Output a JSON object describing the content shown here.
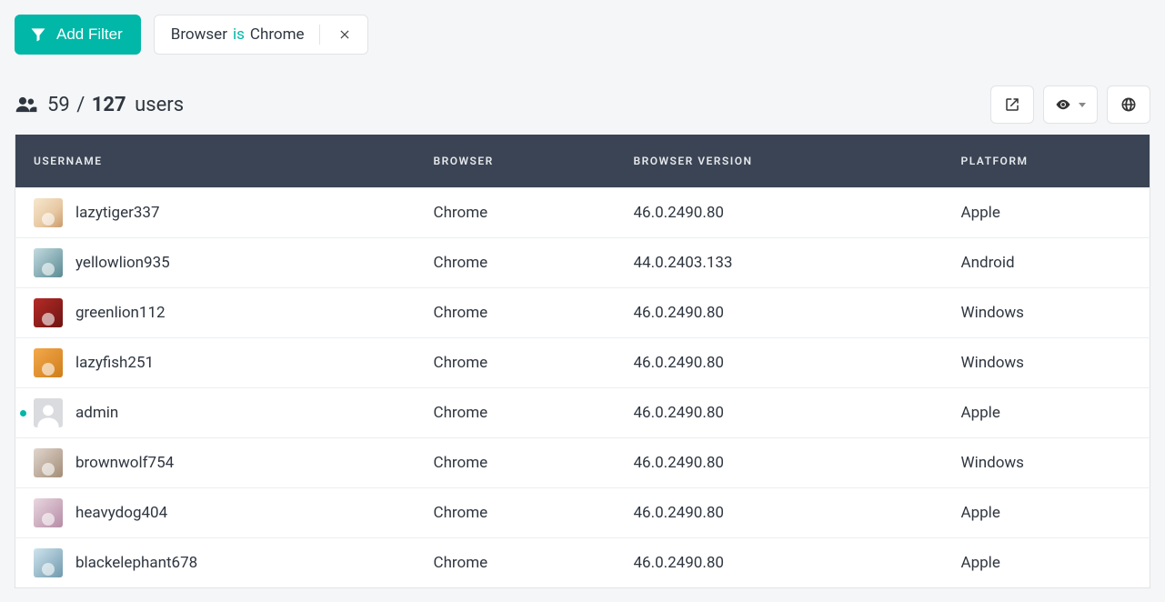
{
  "filters": {
    "add_label": "Add Filter",
    "chip": {
      "field": "Browser",
      "operator": "is",
      "value": "Chrome"
    }
  },
  "summary": {
    "shown": "59",
    "separator": "/",
    "total": "127",
    "unit": "users"
  },
  "columns": {
    "username": "USERNAME",
    "browser": "BROWSER",
    "version": "BROWSER VERSION",
    "platform": "PLATFORM"
  },
  "rows": [
    {
      "username": "lazytiger337",
      "browser": "Chrome",
      "version": "46.0.2490.80",
      "platform": "Apple",
      "avatar": "av-1",
      "online": false
    },
    {
      "username": "yellowlion935",
      "browser": "Chrome",
      "version": "44.0.2403.133",
      "platform": "Android",
      "avatar": "av-2",
      "online": false
    },
    {
      "username": "greenlion112",
      "browser": "Chrome",
      "version": "46.0.2490.80",
      "platform": "Windows",
      "avatar": "av-3",
      "online": false
    },
    {
      "username": "lazyfish251",
      "browser": "Chrome",
      "version": "46.0.2490.80",
      "platform": "Windows",
      "avatar": "av-4",
      "online": false
    },
    {
      "username": "admin",
      "browser": "Chrome",
      "version": "46.0.2490.80",
      "platform": "Apple",
      "avatar": "placeholder",
      "online": true
    },
    {
      "username": "brownwolf754",
      "browser": "Chrome",
      "version": "46.0.2490.80",
      "platform": "Windows",
      "avatar": "av-6",
      "online": false
    },
    {
      "username": "heavydog404",
      "browser": "Chrome",
      "version": "46.0.2490.80",
      "platform": "Apple",
      "avatar": "av-7",
      "online": false
    },
    {
      "username": "blackelephant678",
      "browser": "Chrome",
      "version": "46.0.2490.80",
      "platform": "Apple",
      "avatar": "av-8",
      "online": false
    }
  ]
}
